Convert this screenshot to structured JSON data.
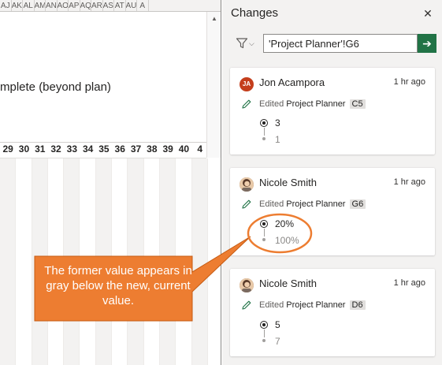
{
  "sheet": {
    "column_headers": [
      "AJ",
      "AK",
      "AL",
      "AM",
      "AN",
      "AO",
      "AP",
      "AQ",
      "AR",
      "AS",
      "AT",
      "AU",
      "A"
    ],
    "cell_text": "mplete (beyond plan)",
    "day_numbers": [
      "29",
      "30",
      "31",
      "32",
      "33",
      "34",
      "35",
      "36",
      "37",
      "38",
      "39",
      "40",
      "4"
    ],
    "scroll_up_icon": "chevron-up-icon"
  },
  "pane": {
    "title": "Changes",
    "close_icon": "close-icon",
    "filter_icon": "filter-icon",
    "filter_value": "'Project Planner'!G6",
    "go_icon": "arrow-right-icon"
  },
  "cards": [
    {
      "initials": "JA",
      "avatar_color": "#c43e1c",
      "name": "Jon Acampora",
      "time": "1 hr ago",
      "action": "Edited",
      "sheet": "Project Planner",
      "cell": "C5",
      "new_value": "3",
      "old_value": "1"
    },
    {
      "initials": "",
      "avatar_color": "#8f6a54",
      "name": "Nicole Smith",
      "time": "1 hr ago",
      "action": "Edited",
      "sheet": "Project Planner",
      "cell": "G6",
      "new_value": "20%",
      "old_value": "100%"
    },
    {
      "initials": "",
      "avatar_color": "#8f6a54",
      "name": "Nicole Smith",
      "time": "1 hr ago",
      "action": "Edited",
      "sheet": "Project Planner",
      "cell": "D6",
      "new_value": "5",
      "old_value": "7"
    }
  ],
  "callout": {
    "text": "The former value appears in gray below the new, current value.",
    "fill_color": "#ed7d31",
    "highlight_color": "#ed7d31"
  }
}
